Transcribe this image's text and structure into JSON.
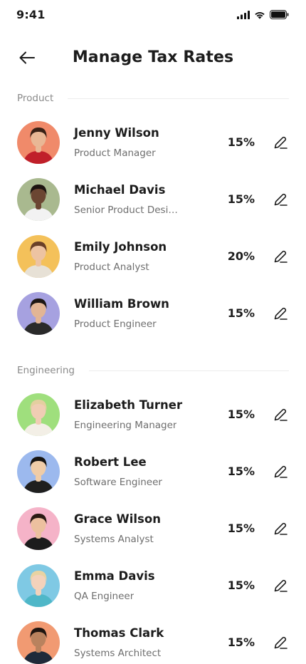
{
  "status_bar": {
    "time": "9:41"
  },
  "header": {
    "title": "Manage Tax Rates"
  },
  "colors": {
    "text": "#1c1c1c",
    "muted": "#6e6e6e",
    "section": "#8a8a8a"
  },
  "sections": [
    {
      "label": "Product",
      "people": [
        {
          "name": "Jenny Wilson",
          "role": "Product Manager",
          "rate": "15%",
          "avatar_bg": "#f08a6a",
          "skin": "#e9b795",
          "hair": "#3a2116",
          "shirt": "#c0202a"
        },
        {
          "name": "Michael Davis",
          "role": "Senior Product Design...",
          "rate": "15%",
          "avatar_bg": "#a9b98f",
          "skin": "#6b4632",
          "hair": "#1d1410",
          "shirt": "#f2f2f2"
        },
        {
          "name": "Emily Johnson",
          "role": "Product Analyst",
          "rate": "20%",
          "avatar_bg": "#f4c15a",
          "skin": "#edc3a2",
          "hair": "#6a4028",
          "shirt": "#e7e1d6"
        },
        {
          "name": "William Brown",
          "role": "Product Engineer",
          "rate": "15%",
          "avatar_bg": "#a6a1e0",
          "skin": "#e2b595",
          "hair": "#1d1714",
          "shirt": "#2a2a2a"
        }
      ]
    },
    {
      "label": "Engineering",
      "people": [
        {
          "name": "Elizabeth Turner",
          "role": "Engineering Manager",
          "rate": "15%",
          "avatar_bg": "#9fdf7d",
          "skin": "#f0cdb4",
          "hair": "#e4cfa0",
          "shirt": "#f3efe6"
        },
        {
          "name": "Robert Lee",
          "role": "Software Engineer",
          "rate": "15%",
          "avatar_bg": "#9cb9ee",
          "skin": "#efcca8",
          "hair": "#161412",
          "shirt": "#1f1f1f"
        },
        {
          "name": "Grace Wilson",
          "role": "Systems Analyst",
          "rate": "15%",
          "avatar_bg": "#f5b3c8",
          "skin": "#ecc09f",
          "hair": "#2a1a12",
          "shirt": "#1c1c1c"
        },
        {
          "name": "Emma Davis",
          "role": "QA Engineer",
          "rate": "15%",
          "avatar_bg": "#7fc9e4",
          "skin": "#f3d2bb",
          "hair": "#e8d3a2",
          "shirt": "#4fb7c8"
        },
        {
          "name": "Thomas Clark",
          "role": "Systems Architect",
          "rate": "15%",
          "avatar_bg": "#f19a72",
          "skin": "#b9825e",
          "hair": "#1f1510",
          "shirt": "#1f2a3a"
        }
      ]
    }
  ]
}
